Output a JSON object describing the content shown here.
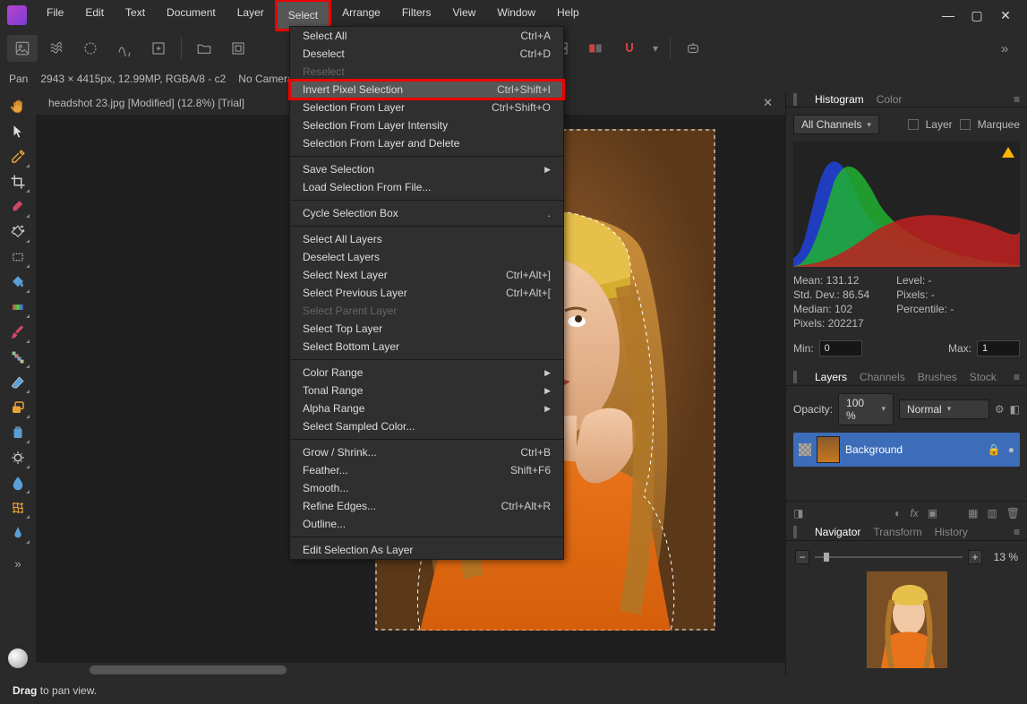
{
  "menubar": [
    "File",
    "Edit",
    "Text",
    "Document",
    "Layer",
    "Select",
    "Arrange",
    "Filters",
    "View",
    "Window",
    "Help"
  ],
  "menubar_highlight_index": 5,
  "context": {
    "tool": "Pan",
    "info": "2943 × 4415px, 12.99MP, RGBA/8 - c2",
    "camera": "No Camera Data"
  },
  "doc_tab": "headshot 23.jpg [Modified] (12.8%) [Trial]",
  "statusbar": {
    "bold": "Drag",
    "rest": "to pan view."
  },
  "select_menu": [
    {
      "t": "item",
      "label": "Select All",
      "sc": "Ctrl+A"
    },
    {
      "t": "item",
      "label": "Deselect",
      "sc": "Ctrl+D"
    },
    {
      "t": "item",
      "label": "Reselect",
      "disabled": true
    },
    {
      "t": "item",
      "label": "Invert Pixel Selection",
      "sc": "Ctrl+Shift+I",
      "hl": true
    },
    {
      "t": "item",
      "label": "Selection From Layer",
      "sc": "Ctrl+Shift+O"
    },
    {
      "t": "item",
      "label": "Selection From Layer Intensity"
    },
    {
      "t": "item",
      "label": "Selection From Layer and Delete"
    },
    {
      "t": "sep"
    },
    {
      "t": "item",
      "label": "Save Selection",
      "sub": true
    },
    {
      "t": "item",
      "label": "Load Selection From File..."
    },
    {
      "t": "sep"
    },
    {
      "t": "item",
      "label": "Cycle Selection Box",
      "sc": "."
    },
    {
      "t": "sep"
    },
    {
      "t": "item",
      "label": "Select All Layers"
    },
    {
      "t": "item",
      "label": "Deselect Layers"
    },
    {
      "t": "item",
      "label": "Select Next Layer",
      "sc": "Ctrl+Alt+]"
    },
    {
      "t": "item",
      "label": "Select Previous Layer",
      "sc": "Ctrl+Alt+["
    },
    {
      "t": "item",
      "label": "Select Parent Layer",
      "disabled": true
    },
    {
      "t": "item",
      "label": "Select Top Layer"
    },
    {
      "t": "item",
      "label": "Select Bottom Layer"
    },
    {
      "t": "sep"
    },
    {
      "t": "item",
      "label": "Color Range",
      "sub": true
    },
    {
      "t": "item",
      "label": "Tonal Range",
      "sub": true
    },
    {
      "t": "item",
      "label": "Alpha Range",
      "sub": true
    },
    {
      "t": "item",
      "label": "Select Sampled Color..."
    },
    {
      "t": "sep"
    },
    {
      "t": "item",
      "label": "Grow / Shrink...",
      "sc": "Ctrl+B"
    },
    {
      "t": "item",
      "label": "Feather...",
      "sc": "Shift+F6"
    },
    {
      "t": "item",
      "label": "Smooth..."
    },
    {
      "t": "item",
      "label": "Refine Edges...",
      "sc": "Ctrl+Alt+R"
    },
    {
      "t": "item",
      "label": "Outline..."
    },
    {
      "t": "sep"
    },
    {
      "t": "item",
      "label": "Edit Selection As Layer"
    }
  ],
  "histogram": {
    "tabs": [
      "Histogram",
      "Color"
    ],
    "active_tab": 0,
    "channels": "All Channels",
    "layer_chk": "Layer",
    "marquee_chk": "Marquee",
    "stats": {
      "mean": "Mean: 131.12",
      "std": "Std. Dev.: 86.54",
      "median": "Median: 102",
      "pixels": "Pixels: 202217",
      "level": "Level: -",
      "px": "Pixels: -",
      "pct": "Percentile: -"
    },
    "min_label": "Min:",
    "min_val": "0",
    "max_label": "Max:",
    "max_val": "1"
  },
  "layers": {
    "tabs": [
      "Layers",
      "Channels",
      "Brushes",
      "Stock"
    ],
    "active_tab": 0,
    "opacity_label": "Opacity:",
    "opacity_val": "100 %",
    "blend": "Normal",
    "layer_name": "Background"
  },
  "navigator": {
    "tabs": [
      "Navigator",
      "Transform",
      "History"
    ],
    "active_tab": 0,
    "zoom": "13 %"
  }
}
